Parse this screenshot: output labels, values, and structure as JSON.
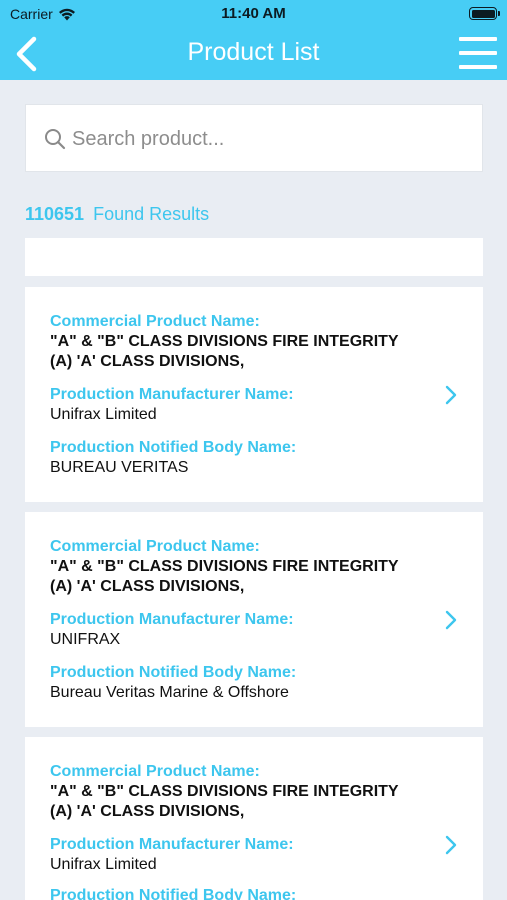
{
  "status_bar": {
    "carrier": "Carrier",
    "time": "11:40 AM"
  },
  "nav": {
    "title": "Product List",
    "back_icon": "chevron-left-icon",
    "menu_icon": "hamburger-menu-icon"
  },
  "search": {
    "placeholder": "Search product...",
    "value": ""
  },
  "results": {
    "count": "110651",
    "label": "Found Results"
  },
  "labels": {
    "commercial": "Commercial Product Name:",
    "manufacturer": "Production Manufacturer Name:",
    "notified": "Production Notified Body Name:"
  },
  "products": [
    {
      "name_line1": "\"A\" & \"B\" CLASS DIVISIONS FIRE INTEGRITY",
      "name_line2": "(A) 'A' CLASS DIVISIONS,",
      "manufacturer": "Unifrax Limited",
      "notified_body": "BUREAU VERITAS"
    },
    {
      "name_line1": "\"A\" & \"B\" CLASS DIVISIONS FIRE INTEGRITY",
      "name_line2": "(A) 'A' CLASS DIVISIONS,",
      "manufacturer": "UNIFRAX",
      "notified_body": "Bureau Veritas Marine & Offshore"
    },
    {
      "name_line1": "\"A\" & \"B\" CLASS DIVISIONS FIRE INTEGRITY",
      "name_line2": "(A) 'A' CLASS DIVISIONS,",
      "manufacturer": "Unifrax Limited",
      "notified_body": ""
    }
  ],
  "colors": {
    "accent": "#47cdf5",
    "label": "#3dc6ee",
    "background": "#e9edf3"
  }
}
